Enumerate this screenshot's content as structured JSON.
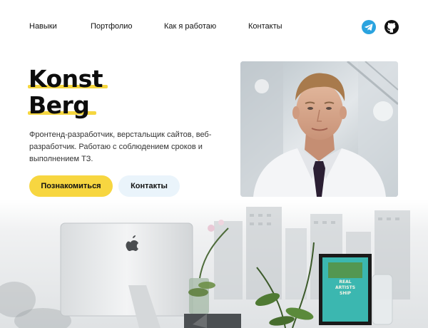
{
  "nav": {
    "items": [
      {
        "label": "Навыки"
      },
      {
        "label": "Портфолио"
      },
      {
        "label": "Как я работаю"
      },
      {
        "label": "Контакты"
      }
    ],
    "social": [
      {
        "icon": "telegram-icon",
        "color": "#2aa3df"
      },
      {
        "icon": "github-icon",
        "color": "#111111"
      }
    ]
  },
  "hero": {
    "title_line1": "Konst",
    "title_line2": "Berg",
    "highlight_color": "#f5d63f",
    "description": "Фронтенд-разработчик, верстальщик сайтов, веб-разработчик. Работаю с соблюдением сроков и выполнением ТЗ.",
    "primary_button": "Познакомиться",
    "secondary_button": "Контакты"
  },
  "colors": {
    "accent_yellow": "#f7d640",
    "secondary_button_bg": "#eaf4fb"
  },
  "images": {
    "portrait": "portrait-photo",
    "workspace": "workspace-photo",
    "poster_lines": [
      "REAL",
      "ARTISTS",
      "SHIP"
    ]
  }
}
